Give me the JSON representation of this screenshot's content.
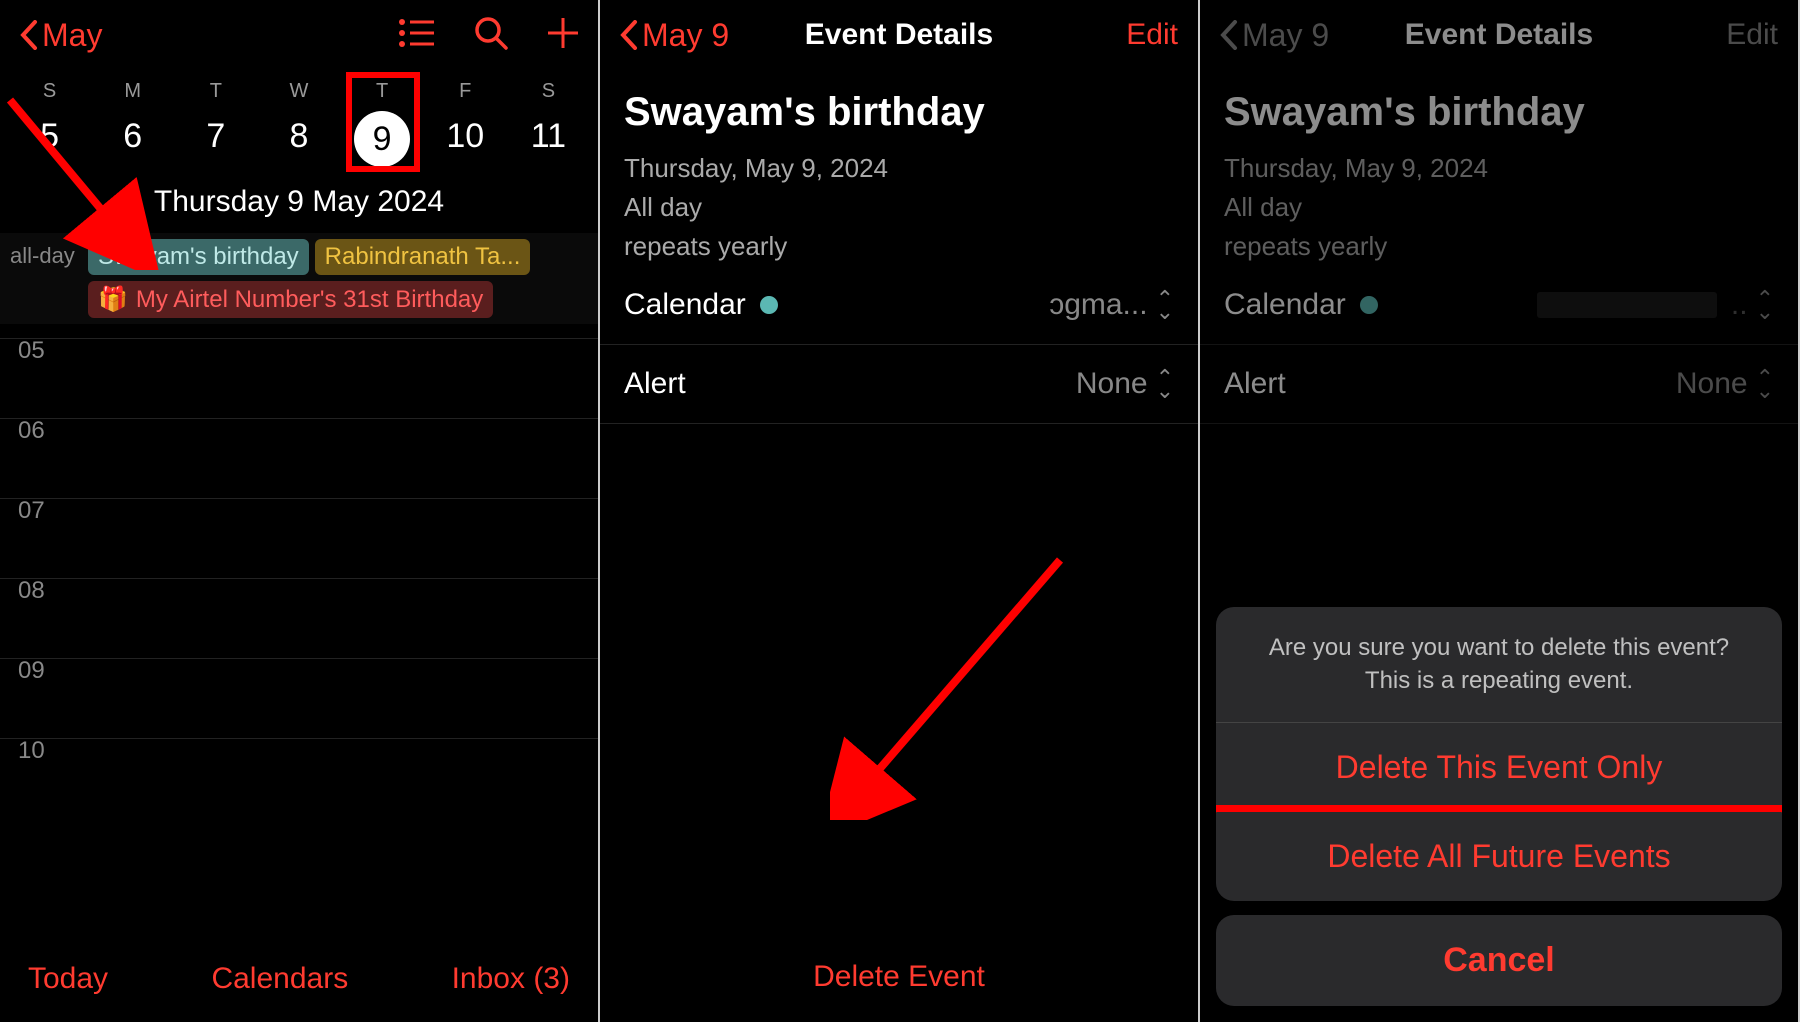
{
  "panel1": {
    "back_label": "May",
    "dows": [
      "S",
      "M",
      "T",
      "W",
      "T",
      "F",
      "S"
    ],
    "dates": [
      "5",
      "6",
      "7",
      "8",
      "9",
      "10",
      "11"
    ],
    "selected_index": 4,
    "date_heading": "Thursday  9 May 2024",
    "allday_label": "all-day",
    "event1": "Swayam's birthday",
    "event2": "Rabindranath Ta...",
    "event3": "My Airtel Number's 31st Birthday",
    "hours": [
      "05",
      "06",
      "07",
      "08",
      "09",
      "10"
    ],
    "today": "Today",
    "calendars": "Calendars",
    "inbox": "Inbox  (3)"
  },
  "panel2": {
    "back_label": "May 9",
    "title": "Event Details",
    "edit": "Edit",
    "event_title": "Swayam's birthday",
    "event_date": "Thursday, May 9, 2024",
    "event_allday": "All day",
    "event_repeat": "repeats yearly",
    "calendar_label": "Calendar",
    "calendar_dot": "#5bb8b3",
    "calendar_value": "ᴐgma...",
    "alert_label": "Alert",
    "alert_value": "None",
    "delete": "Delete Event"
  },
  "panel3": {
    "back_label": "May 9",
    "title": "Event Details",
    "edit": "Edit",
    "event_title": "Swayam's birthday",
    "event_date": "Thursday, May 9, 2024",
    "event_allday": "All day",
    "event_repeat": "repeats yearly",
    "calendar_label": "Calendar",
    "calendar_dot": "#5bb8b3",
    "alert_label": "Alert",
    "alert_value": "None",
    "sheet_msg_1": "Are you sure you want to delete this event?",
    "sheet_msg_2": "This is a repeating event.",
    "delete_this": "Delete This Event Only",
    "delete_all": "Delete All Future Events",
    "cancel": "Cancel"
  }
}
